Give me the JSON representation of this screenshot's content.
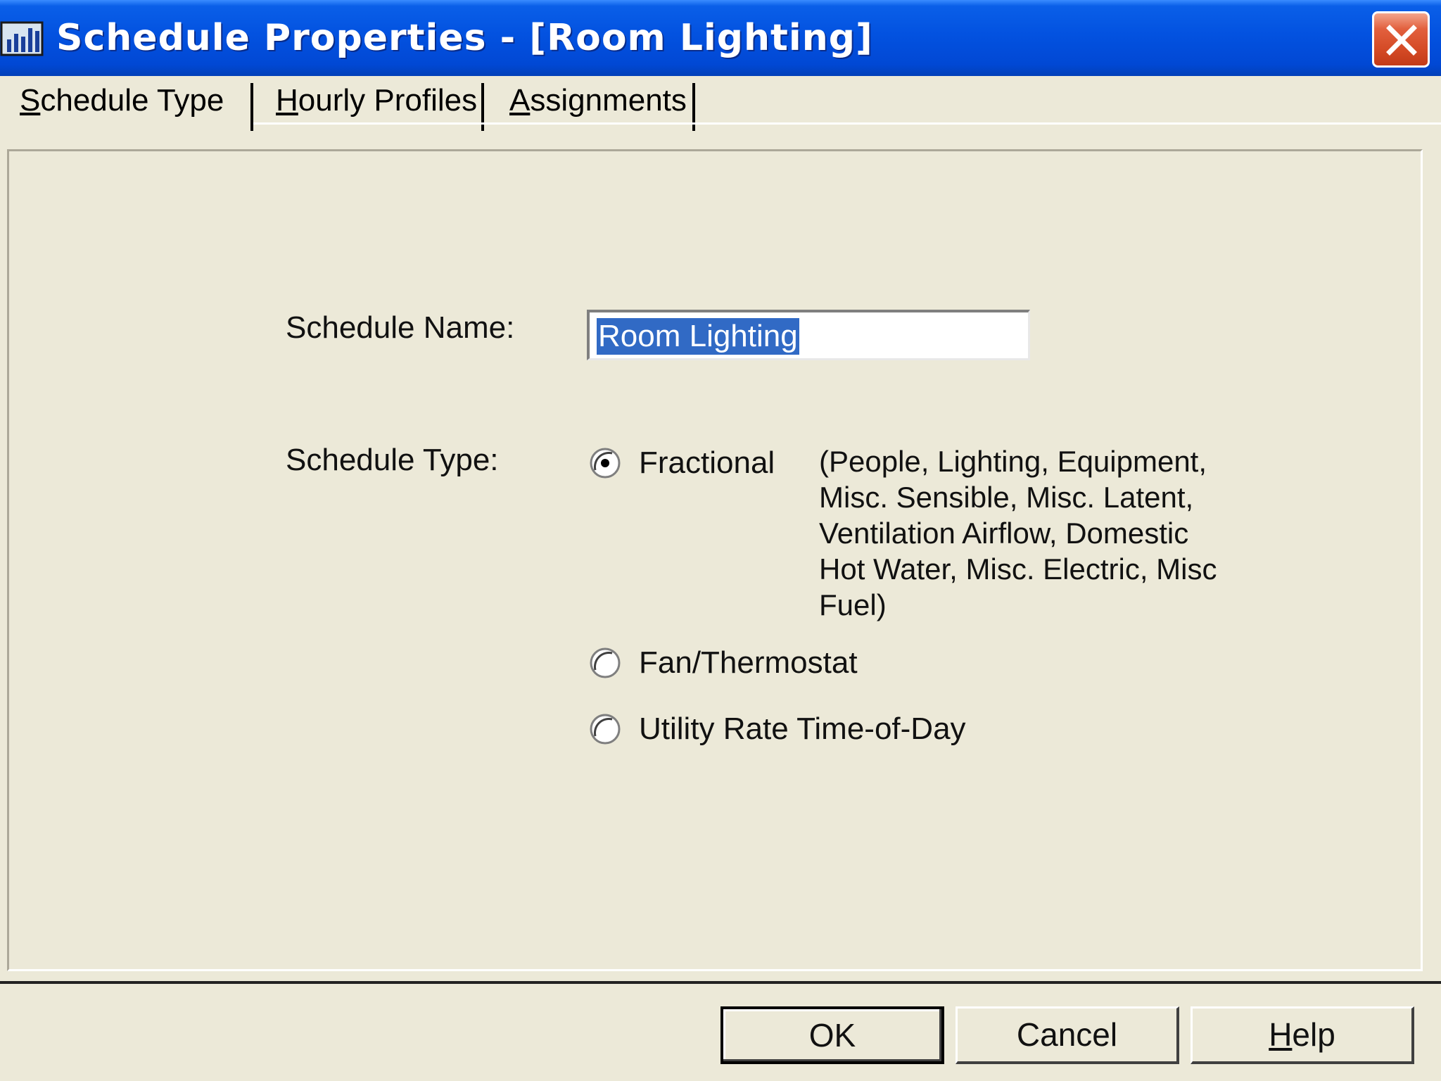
{
  "window": {
    "title": "Schedule Properties - [Room Lighting]",
    "accent_color": "#0352E0",
    "close_color": "#D44A25",
    "icon": "schedule-chart-icon"
  },
  "tabs": [
    {
      "label_first": "S",
      "label_rest": "chedule Type",
      "active": true
    },
    {
      "label_first": "H",
      "label_rest": "ourly Profiles",
      "active": false
    },
    {
      "label_first": "A",
      "label_rest": "ssignments",
      "active": false
    }
  ],
  "form": {
    "name_label": "Schedule Name:",
    "name_value": "Room Lighting",
    "type_label": "Schedule Type:",
    "options": [
      {
        "label": "Fractional",
        "selected": true
      },
      {
        "label": "Fan/Thermostat",
        "selected": false
      },
      {
        "label": "Utility Rate Time-of-Day",
        "selected": false
      }
    ],
    "fractional_description": "(People, Lighting, Equipment, Misc. Sensible, Misc. Latent, Ventilation Airflow, Domestic Hot Water, Misc. Electric, Misc Fuel)"
  },
  "buttons": {
    "ok": "OK",
    "cancel": "Cancel",
    "help_first": "H",
    "help_rest": "elp"
  },
  "colors": {
    "dialog_bg": "#ECE9D8",
    "selection_bg": "#316AC5"
  }
}
